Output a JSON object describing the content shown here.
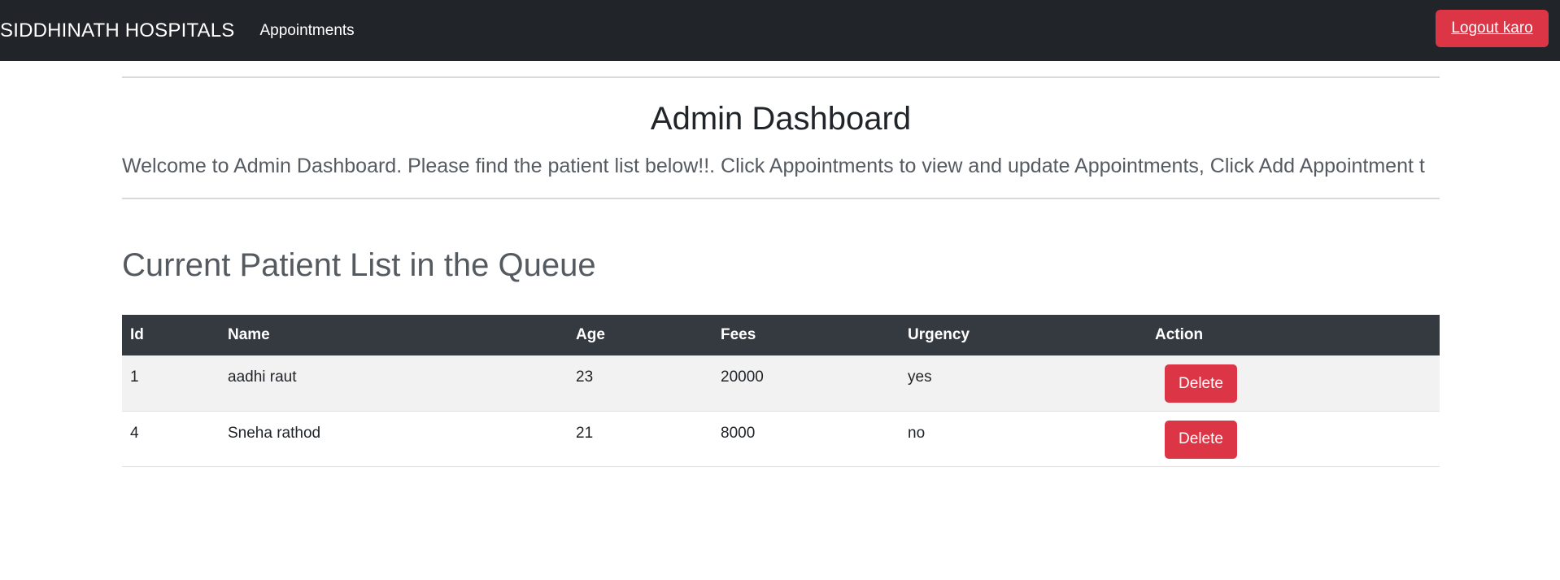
{
  "navbar": {
    "brand": "SIDDHINATH HOSPITALS",
    "appointments_label": "Appointments",
    "logout_label": "Logout karo"
  },
  "header": {
    "title": "Admin Dashboard",
    "welcome": "Welcome to Admin Dashboard. Please find the patient list below!!. Click Appointments to view and update Appointments, Click Add Appointment t"
  },
  "patients": {
    "title": "Current Patient List in the Queue",
    "columns": [
      "Id",
      "Name",
      "Age",
      "Fees",
      "Urgency",
      "Action"
    ],
    "rows": [
      {
        "id": "1",
        "name": "aadhi raut",
        "age": "23",
        "fees": "20000",
        "urgency": "yes",
        "action": "Delete"
      },
      {
        "id": "4",
        "name": "Sneha rathod",
        "age": "21",
        "fees": "8000",
        "urgency": "no",
        "action": "Delete"
      }
    ]
  },
  "colors": {
    "navbar_bg": "#212529",
    "danger": "#dc3545",
    "table_header_bg": "#343a40"
  }
}
